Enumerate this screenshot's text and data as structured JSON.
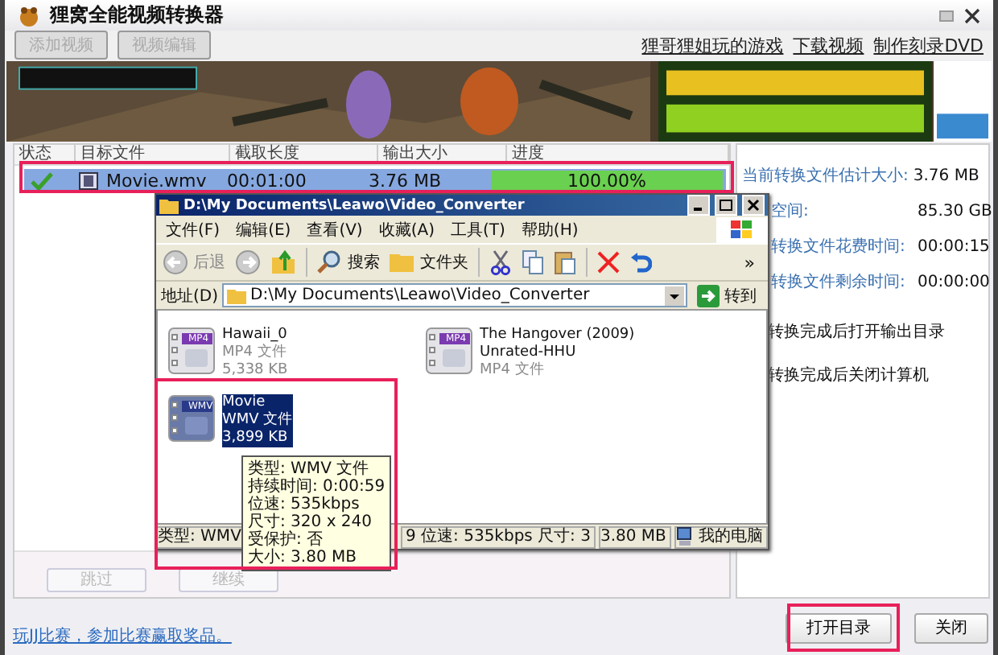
{
  "window": {
    "title": "狸窝全能视频转换器"
  },
  "toolbar": {
    "buttons": [
      {
        "label": "添加视频",
        "disabled": true
      },
      {
        "label": "视频编辑",
        "disabled": true
      }
    ],
    "links": [
      "狸哥狸姐玩的游戏",
      "下载视频",
      "制作刻录DVD"
    ]
  },
  "banner": {
    "kind": "picture"
  },
  "table": {
    "columns": [
      "状态",
      "目标文件",
      "截取长度",
      "输出大小",
      "进度"
    ],
    "rows": [
      {
        "done": true,
        "selected": true,
        "file": "Movie.wmv",
        "length": "00:01:00",
        "size": "3.76 MB",
        "progress": "100.00%",
        "level": 1
      }
    ]
  },
  "info": [
    {
      "kind": "full",
      "label": "当前转换文件估计大小:",
      "value": "3.76 MB"
    },
    {
      "kind": "clipped",
      "label": "空间:",
      "value": "85.30 GB"
    },
    {
      "kind": "clipped",
      "label": "转换文件花费时间:",
      "value": "00:00:15"
    },
    {
      "kind": "clipped",
      "label": "转换文件剩余时间:",
      "value": "00:00:00"
    }
  ],
  "options": [
    "转换完成后打开输出目录",
    "转换完成后关闭计算机"
  ],
  "actions": [
    {
      "label": "跳过",
      "disabled": true
    },
    {
      "label": "继续",
      "disabled": true
    }
  ],
  "promo_link": "玩JJ比赛，参加比赛赢取奖品。",
  "footer_buttons": [
    "打开目录",
    "关闭"
  ],
  "explorer": {
    "title": "D:\\My Documents\\Leawo\\Video_Converter",
    "menu": [
      "文件(F)",
      "编辑(E)",
      "查看(V)",
      "收藏(A)",
      "工具(T)",
      "帮助(H)"
    ],
    "back": "后退",
    "search": "搜索",
    "folders": "文件夹",
    "more": "»",
    "address_label": "地址(D)",
    "address": "D:\\My Documents\\Leawo\\Video_Converter",
    "go": "转到",
    "files": [
      {
        "badge": "MP4",
        "lines": [
          "Hawaii_0"
        ],
        "type": "MP4 文件",
        "size": "5,338 KB",
        "selected": false
      },
      {
        "badge": "MP4",
        "lines": [
          "The Hangover (2009)",
          "Unrated-HHU"
        ],
        "type": "MP4 文件",
        "selected": false
      },
      {
        "badge": "WMV",
        "lines": [
          "Movie"
        ],
        "type": "WMV 文件",
        "size": "3,899 KB",
        "selected": true
      }
    ],
    "status": [
      "类型: WMV",
      "9 位速: 535kbps 尺寸: 3",
      "3.80 MB",
      "我的电脑"
    ],
    "tooltip": [
      "类型: WMV 文件",
      "持续时间: 0:00:59",
      "位速: 535kbps",
      "尺寸: 320 x 240",
      "受保护: 否",
      "大小: 3.80 MB"
    ]
  }
}
